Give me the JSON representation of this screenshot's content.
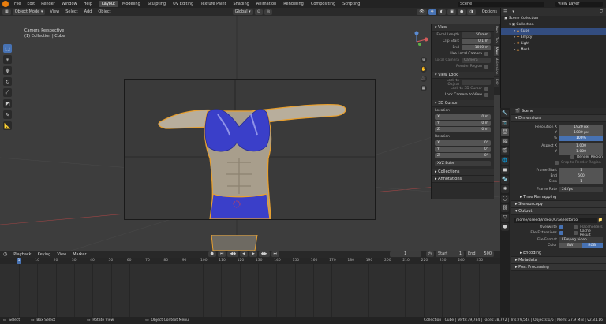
{
  "topbar": {
    "menus": [
      "File",
      "Edit",
      "Render",
      "Window",
      "Help"
    ],
    "workspaces": [
      "Layout",
      "Modeling",
      "Sculpting",
      "UV Editing",
      "Texture Paint",
      "Shading",
      "Animation",
      "Rendering",
      "Compositing",
      "Scripting"
    ],
    "active_workspace": "Layout",
    "scene_label": "Scene",
    "view_layer_label": "View Layer"
  },
  "vp_header": {
    "mode": "Object Mode",
    "menus": [
      "View",
      "Select",
      "Add",
      "Object"
    ],
    "transform": "Global",
    "options": "Options"
  },
  "viewport": {
    "camera_label": "Camera Perspective",
    "collection_label": "(1) Collection | Cube"
  },
  "sidebar": {
    "view_title": "View",
    "focal_length_label": "Focal Length",
    "focal_length": "50 mm",
    "clip_start_label": "Clip Start",
    "clip_start": "0.1 m",
    "end_label": "End",
    "end": "1000 m",
    "use_local_camera": "Use Local Camera",
    "local_camera_label": "Local Camera",
    "local_camera": "Camera",
    "render_region": "Render Region",
    "view_lock_title": "View Lock",
    "lock_to_object": "Lock to Object",
    "lock_3d_cursor": "Lock to 3D Cursor",
    "lock_camera": "Lock Camera to View",
    "cursor_title": "3D Cursor",
    "location_label": "Location",
    "loc_x": "0 m",
    "loc_y": "0 m",
    "loc_z": "0 m",
    "rotation_label": "Rotation",
    "rot_x": "0°",
    "rot_y": "0°",
    "rot_z": "0°",
    "rot_mode": "XYZ Euler",
    "collections": "Collections",
    "annotations": "Annotations",
    "tabs": [
      "Item",
      "Tool",
      "View",
      "Animation",
      "Edit"
    ]
  },
  "outliner": {
    "items": [
      {
        "label": "Scene Collection",
        "indent": 0,
        "selected": false
      },
      {
        "label": "Collection",
        "indent": 1,
        "selected": false
      },
      {
        "label": "Cube",
        "indent": 2,
        "selected": true
      },
      {
        "label": "Empty",
        "indent": 2,
        "selected": false
      },
      {
        "label": "Light",
        "indent": 2,
        "selected": false
      },
      {
        "label": "Mesh",
        "indent": 2,
        "selected": false
      }
    ]
  },
  "props": {
    "scene_label": "Scene",
    "dimensions_title": "Dimensions",
    "res_x_label": "Resolution X",
    "res_x": "1920 px",
    "res_y_label": "Y",
    "res_y": "1080 px",
    "res_pct_label": "%",
    "res_pct": "100%",
    "aspect_x_label": "Aspect X",
    "aspect_x": "1.000",
    "aspect_y_label": "Y",
    "aspect_y": "1.000",
    "render_region": "Render Region",
    "crop_region": "Crop to Render Region",
    "frame_start_label": "Frame Start",
    "frame_start": "1",
    "frame_end_label": "End",
    "frame_end": "500",
    "frame_step_label": "Step",
    "frame_step": "1",
    "frame_rate_label": "Frame Rate",
    "frame_rate": "24 fps",
    "time_remap": "Time Remapping",
    "stereoscopy": "Stereoscopy",
    "output_title": "Output",
    "output_path": "/home/lsseed/Videos/Crae/lestorso",
    "overwrite": "Overwrite",
    "placeholders": "Placeholders",
    "file_extensions": "File Extensions",
    "cache_result": "Cache Result",
    "file_format_label": "File Format",
    "file_format": "FFmpeg video",
    "color_label": "Color",
    "color_bw": "BW",
    "color_rgb": "RGB",
    "encoding": "Encoding",
    "metadata": "Metadata",
    "post_processing": "Post Processing"
  },
  "timeline": {
    "menus": [
      "Playback",
      "Keying",
      "View",
      "Marker"
    ],
    "current_frame": "1",
    "start_label": "Start",
    "start": "1",
    "end_label": "End",
    "end": "500",
    "ticks": [
      "0",
      "10",
      "20",
      "30",
      "40",
      "50",
      "60",
      "70",
      "80",
      "90",
      "100",
      "110",
      "120",
      "130",
      "140",
      "150",
      "160",
      "170",
      "180",
      "190",
      "200",
      "210",
      "220",
      "230",
      "240",
      "250"
    ]
  },
  "status": {
    "select": "Select",
    "box_select": "Box Select",
    "rotate_view": "Rotate View",
    "context_menu": "Object Context Menu",
    "stats": "Collection | Cube | Verts:39,784 | Faces:38,772 | Tris:79,544 | Objects:1/5 | Mem: 27.9 MiB | v2.81.16"
  },
  "colors": {
    "accent": "#4772b3",
    "selection": "#e87d0d",
    "outfit": "#3a3fc9"
  }
}
